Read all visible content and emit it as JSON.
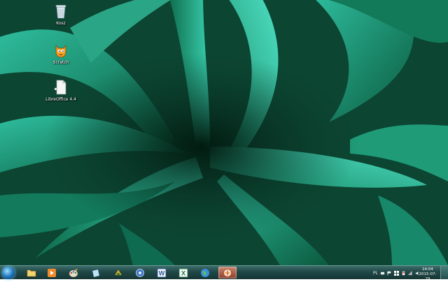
{
  "desktop": {
    "icons": [
      {
        "label": "Kosz",
        "icon": "recycle-bin-icon"
      },
      {
        "label": "Scratch",
        "icon": "scratch-cat-icon"
      },
      {
        "label": "LibreOffice 4.4",
        "icon": "document-file-icon"
      }
    ]
  },
  "taskbar": {
    "start": "windows-start-orb-icon",
    "pinned": [
      "file-explorer-icon",
      "media-player-icon",
      "paint-icon",
      "notepad-icon",
      "game-icon",
      "settings-icon",
      "word-icon",
      "excel-icon",
      "globe-browser-icon",
      "compass-app-icon"
    ],
    "tray": {
      "language": "PL",
      "icons": [
        "network-icon",
        "flag-icon",
        "windows-icon",
        "battery-icon",
        "wifi-icon",
        "volume-icon"
      ]
    },
    "clock": {
      "time": "14:04",
      "date": "2015-07-29"
    }
  }
}
